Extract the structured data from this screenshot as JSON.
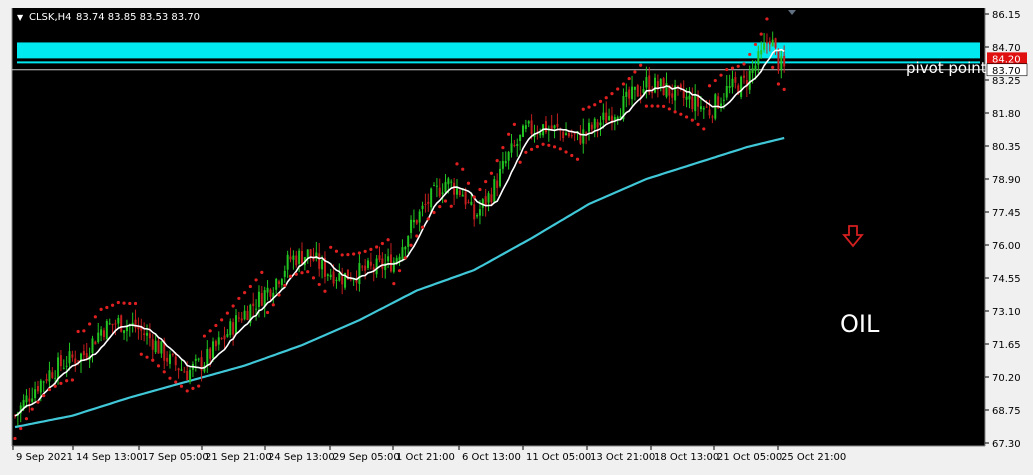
{
  "window": {
    "symbol_header": "CLSK,H4",
    "ohlc_header": "83.74 83.85 83.53 83.70",
    "collapse_glyph": "▼"
  },
  "annotations": {
    "pivot_label": "pivot point",
    "instrument_label": "OIL",
    "arrow_icon": "down-arrow-icon",
    "arrow_color": "#d42020"
  },
  "price_tags": {
    "cyan_zone_tag": "84.20",
    "current_price_tag": "83.70"
  },
  "colors": {
    "background": "#000000",
    "frame": "#f0f0f0",
    "bull_candle": "#22c422",
    "bear_candle": "#c41e1e",
    "fast_ma": "#ffffff",
    "slow_ma": "#40c8d8",
    "parabolic_sar": "#e02020",
    "cyan_zone": "#00e8f0",
    "pivot_line": "#c8c8c8",
    "axis_text": "#000000",
    "price_tag_red": "#e01010"
  },
  "chart_data": {
    "type": "candlestick",
    "y_tick_labels": [
      "86.15",
      "84.70",
      "83.25",
      "81.80",
      "80.35",
      "78.90",
      "77.45",
      "76.00",
      "74.55",
      "73.10",
      "71.65",
      "70.20",
      "68.75",
      "67.30"
    ],
    "ylim": [
      67.3,
      86.15
    ],
    "x_tick_labels": [
      "9 Sep 2021",
      "14 Sep 13:00",
      "17 Sep 05:00",
      "21 Sep 21:00",
      "24 Sep 13:00",
      "29 Sep 05:00",
      "1 Oct 21:00",
      "6 Oct 13:00",
      "11 Oct 05:00",
      "13 Oct 21:00",
      "18 Oct 13:00",
      "21 Oct 05:00",
      "25 Oct 21:00"
    ],
    "last_ohlc": {
      "open": 83.74,
      "high": 83.85,
      "low": 83.53,
      "close": 83.7
    },
    "resistance_zone": [
      84.2,
      84.9
    ],
    "pivot_level": 83.7,
    "close_path": [
      [
        0,
        68.5
      ],
      [
        6,
        69.6
      ],
      [
        12,
        70.4
      ],
      [
        18,
        70.9
      ],
      [
        24,
        71.2
      ],
      [
        30,
        72.3
      ],
      [
        36,
        72.6
      ],
      [
        42,
        72.4
      ],
      [
        48,
        71.8
      ],
      [
        54,
        70.9
      ],
      [
        60,
        70.4
      ],
      [
        66,
        70.9
      ],
      [
        72,
        71.8
      ],
      [
        78,
        72.8
      ],
      [
        84,
        73.5
      ],
      [
        90,
        74.3
      ],
      [
        96,
        75.4
      ],
      [
        102,
        75.6
      ],
      [
        108,
        74.9
      ],
      [
        114,
        74.6
      ],
      [
        120,
        74.8
      ],
      [
        126,
        75.0
      ],
      [
        132,
        75.3
      ],
      [
        138,
        76.8
      ],
      [
        144,
        77.9
      ],
      [
        150,
        78.8
      ],
      [
        156,
        78.3
      ],
      [
        160,
        77.2
      ],
      [
        166,
        78.3
      ],
      [
        172,
        79.9
      ],
      [
        178,
        81.0
      ],
      [
        184,
        81.2
      ],
      [
        190,
        81.0
      ],
      [
        196,
        80.7
      ],
      [
        202,
        81.2
      ],
      [
        208,
        81.8
      ],
      [
        214,
        82.4
      ],
      [
        220,
        83.1
      ],
      [
        226,
        82.9
      ],
      [
        230,
        82.6
      ],
      [
        236,
        82.3
      ],
      [
        242,
        81.9
      ],
      [
        248,
        82.8
      ],
      [
        254,
        83.1
      ],
      [
        260,
        84.3
      ],
      [
        263,
        85.2
      ],
      [
        266,
        84.0
      ],
      [
        268,
        83.7
      ]
    ],
    "slow_ma_path": [
      [
        0,
        68.0
      ],
      [
        20,
        68.5
      ],
      [
        40,
        69.3
      ],
      [
        60,
        70.0
      ],
      [
        80,
        70.7
      ],
      [
        100,
        71.6
      ],
      [
        120,
        72.7
      ],
      [
        140,
        74.0
      ],
      [
        160,
        74.9
      ],
      [
        180,
        76.3
      ],
      [
        200,
        77.8
      ],
      [
        220,
        78.9
      ],
      [
        240,
        79.7
      ],
      [
        255,
        80.3
      ],
      [
        268,
        80.7
      ]
    ]
  }
}
